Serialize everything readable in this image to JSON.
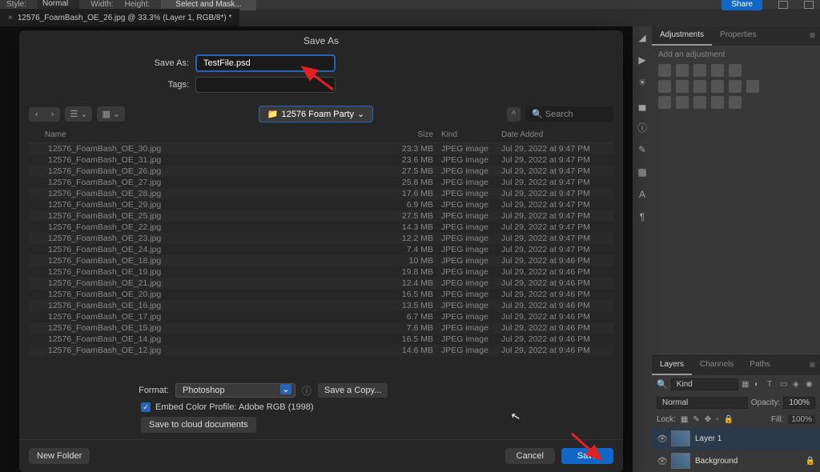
{
  "topbar": {
    "style_label": "Style:",
    "style_value": "Normal",
    "width_label": "Width:",
    "height_label": "Height:",
    "select_mask": "Select and Mask...",
    "share": "Share"
  },
  "doc_tab": {
    "title": "12576_FoamBash_OE_26.jpg @ 33.3% (Layer 1, RGB/8*) *"
  },
  "dialog": {
    "title": "Save As",
    "save_as_label": "Save As:",
    "filename": "TestFile.psd",
    "tags_label": "Tags:",
    "folder": "12576 Foam Party",
    "search_placeholder": "Search",
    "columns": {
      "name": "Name",
      "size": "Size",
      "kind": "Kind",
      "date": "Date Added"
    },
    "files": [
      {
        "name": "12576_FoamBash_OE_30.jpg",
        "size": "23.3 MB",
        "kind": "JPEG image",
        "date": "Jul 29, 2022 at 9:47 PM"
      },
      {
        "name": "12576_FoamBash_OE_31.jpg",
        "size": "23.6 MB",
        "kind": "JPEG image",
        "date": "Jul 29, 2022 at 9:47 PM"
      },
      {
        "name": "12576_FoamBash_OE_26.jpg",
        "size": "27.5 MB",
        "kind": "JPEG image",
        "date": "Jul 29, 2022 at 9:47 PM"
      },
      {
        "name": "12576_FoamBash_OE_27.jpg",
        "size": "25.8 MB",
        "kind": "JPEG image",
        "date": "Jul 29, 2022 at 9:47 PM"
      },
      {
        "name": "12576_FoamBash_OE_28.jpg",
        "size": "17.6 MB",
        "kind": "JPEG image",
        "date": "Jul 29, 2022 at 9:47 PM"
      },
      {
        "name": "12576_FoamBash_OE_29.jpg",
        "size": "6.9 MB",
        "kind": "JPEG image",
        "date": "Jul 29, 2022 at 9:47 PM"
      },
      {
        "name": "12576_FoamBash_OE_25.jpg",
        "size": "27.5 MB",
        "kind": "JPEG image",
        "date": "Jul 29, 2022 at 9:47 PM"
      },
      {
        "name": "12576_FoamBash_OE_22.jpg",
        "size": "14.3 MB",
        "kind": "JPEG image",
        "date": "Jul 29, 2022 at 9:47 PM"
      },
      {
        "name": "12576_FoamBash_OE_23.jpg",
        "size": "12.2 MB",
        "kind": "JPEG image",
        "date": "Jul 29, 2022 at 9:47 PM"
      },
      {
        "name": "12576_FoamBash_OE_24.jpg",
        "size": "7.4 MB",
        "kind": "JPEG image",
        "date": "Jul 29, 2022 at 9:47 PM"
      },
      {
        "name": "12576_FoamBash_OE_18.jpg",
        "size": "10 MB",
        "kind": "JPEG image",
        "date": "Jul 29, 2022 at 9:46 PM"
      },
      {
        "name": "12576_FoamBash_OE_19.jpg",
        "size": "19.8 MB",
        "kind": "JPEG image",
        "date": "Jul 29, 2022 at 9:46 PM"
      },
      {
        "name": "12576_FoamBash_OE_21.jpg",
        "size": "12.4 MB",
        "kind": "JPEG image",
        "date": "Jul 29, 2022 at 9:46 PM"
      },
      {
        "name": "12576_FoamBash_OE_20.jpg",
        "size": "16.5 MB",
        "kind": "JPEG image",
        "date": "Jul 29, 2022 at 9:46 PM"
      },
      {
        "name": "12576_FoamBash_OE_16.jpg",
        "size": "13.5 MB",
        "kind": "JPEG image",
        "date": "Jul 29, 2022 at 9:46 PM"
      },
      {
        "name": "12576_FoamBash_OE_17.jpg",
        "size": "6.7 MB",
        "kind": "JPEG image",
        "date": "Jul 29, 2022 at 9:46 PM"
      },
      {
        "name": "12576_FoamBash_OE_15.jpg",
        "size": "7.6 MB",
        "kind": "JPEG image",
        "date": "Jul 29, 2022 at 9:46 PM"
      },
      {
        "name": "12576_FoamBash_OE_14.jpg",
        "size": "16.5 MB",
        "kind": "JPEG image",
        "date": "Jul 29, 2022 at 9:46 PM"
      },
      {
        "name": "12576_FoamBash_OE_12.jpg",
        "size": "14.6 MB",
        "kind": "JPEG image",
        "date": "Jul 29, 2022 at 9:46 PM"
      }
    ],
    "format_label": "Format:",
    "format_value": "Photoshop",
    "save_copy": "Save a Copy...",
    "embed_label": "Embed Color Profile:  Adobe RGB (1998)",
    "cloud_btn": "Save to cloud documents",
    "new_folder": "New Folder",
    "cancel": "Cancel",
    "save": "Save"
  },
  "panels": {
    "adjustments_tab": "Adjustments",
    "properties_tab": "Properties",
    "add_adjustment": "Add an adjustment",
    "layers_tab": "Layers",
    "channels_tab": "Channels",
    "paths_tab": "Paths",
    "kind": "Kind",
    "normal": "Normal",
    "opacity_label": "Opacity:",
    "opacity_value": "100%",
    "lock_label": "Lock:",
    "fill_label": "Fill:",
    "fill_value": "100%",
    "layer1": "Layer 1",
    "background": "Background"
  }
}
